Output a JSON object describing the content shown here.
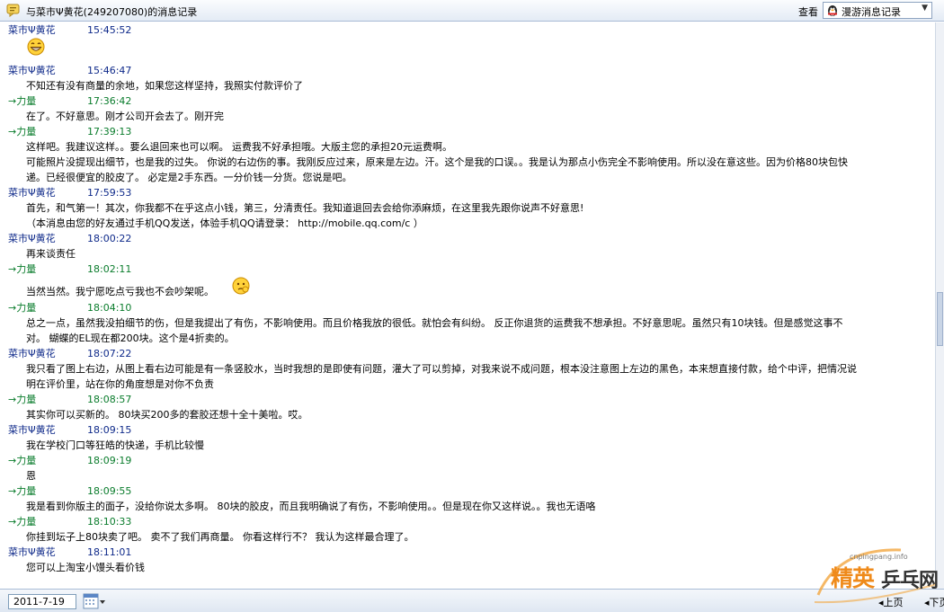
{
  "header": {
    "title": "与菜市Ψ黄花(249207080)的消息记录",
    "view_label": "查看",
    "mode_select": "漫游消息记录"
  },
  "messages": [
    {
      "sender": "菜市Ψ黄花",
      "type": "friend",
      "time": "15:45:52",
      "emoji": "grin",
      "lines": []
    },
    {
      "sender": "菜市Ψ黄花",
      "type": "friend",
      "time": "15:46:47",
      "lines": [
        "不知还有没有商量的余地，如果您这样坚持，我照实付款评价了"
      ]
    },
    {
      "sender": "→力量",
      "type": "self",
      "time": "17:36:42",
      "lines": [
        "在了。不好意思。刚才公司开会去了。刚开完"
      ]
    },
    {
      "sender": "→力量",
      "type": "self",
      "time": "17:39:13",
      "lines": [
        "这样吧。我建议这样。。要么退回来也可以啊。  运费我不好承担哦。大版主您的承担20元运费啊。",
        "可能照片没提现出细节，也是我的过失。  你说的右边伤的事。我刚反应过来，原来是左边。汗。这个是我的口误。。我是认为那点小伤完全不影响使用。所以没在意这些。因为价格80块包快",
        "递。已经很便宜的胶皮了。  必定是2手东西。一分价钱一分货。您说是吧。"
      ]
    },
    {
      "sender": "菜市Ψ黄花",
      "type": "friend",
      "time": "17:59:53",
      "lines": [
        "首先，和气第一！其次，你我都不在乎这点小钱，第三，分清责任。我知道退回去会给你添麻烦，在这里我先跟你说声不好意思!",
        "（本消息由您的好友通过手机QQ发送，体验手机QQ请登录： http://mobile.qq.com/c ）"
      ]
    },
    {
      "sender": "菜市Ψ黄花",
      "type": "friend",
      "time": "18:00:22",
      "lines": [
        "再来谈责任"
      ]
    },
    {
      "sender": "→力量",
      "type": "self",
      "time": "18:02:11",
      "emoji": "think",
      "lines": [
        "当然当然。我宁愿吃点亏我也不会吵架呢。"
      ]
    },
    {
      "sender": "→力量",
      "type": "self",
      "time": "18:04:10",
      "lines": [
        "总之一点，虽然我没拍细节的伤，但是我提出了有伤，不影响使用。而且价格我放的很低。就怕会有纠纷。  反正你退货的运费我不想承担。不好意思呢。虽然只有10块钱。但是感觉这事不",
        "对。  蝴蝶的EL现在都200块。这个是4折卖的。"
      ]
    },
    {
      "sender": "菜市Ψ黄花",
      "type": "friend",
      "time": "18:07:22",
      "lines": [
        "我只看了图上右边，从图上看右边可能是有一条竖胶水，当时我想的是即使有问题，灌大了可以剪掉，对我来说不成问题，根本没注意图上左边的黑色，本来想直接付款，给个中评，把情况说",
        "明在评价里，站在你的角度想是对你不负责"
      ]
    },
    {
      "sender": "→力量",
      "type": "self",
      "time": "18:08:57",
      "lines": [
        "其实你可以买新的。  80块买200多的套胶还想十全十美啦。哎。"
      ]
    },
    {
      "sender": "菜市Ψ黄花",
      "type": "friend",
      "time": "18:09:15",
      "lines": [
        "我在学校门口等狂皓的快递，手机比较慢"
      ]
    },
    {
      "sender": "→力量",
      "type": "self",
      "time": "18:09:19",
      "lines": [
        "恩"
      ]
    },
    {
      "sender": "→力量",
      "type": "self",
      "time": "18:09:55",
      "lines": [
        "我是看到你版主的面子，没给你说太多啊。  80块的胶皮，而且我明确说了有伤，不影响使用。。但是现在你又这样说。。我也无语咯"
      ]
    },
    {
      "sender": "→力量",
      "type": "self",
      "time": "18:10:33",
      "lines": [
        "你挂到坛子上80块卖了吧。  卖不了我们再商量。  你看这样行不？  我认为这样最合理了。"
      ]
    },
    {
      "sender": "菜市Ψ黄花",
      "type": "friend",
      "time": "18:11:01",
      "lines": [
        "您可以上淘宝小馒头看价钱"
      ]
    }
  ],
  "footer": {
    "date": "2011-7-19",
    "prev_page": "上页",
    "next_page": "下页"
  },
  "watermark": {
    "url": "cnpingpang.info",
    "text_a": "精英",
    "text_b": "乒乓网"
  }
}
